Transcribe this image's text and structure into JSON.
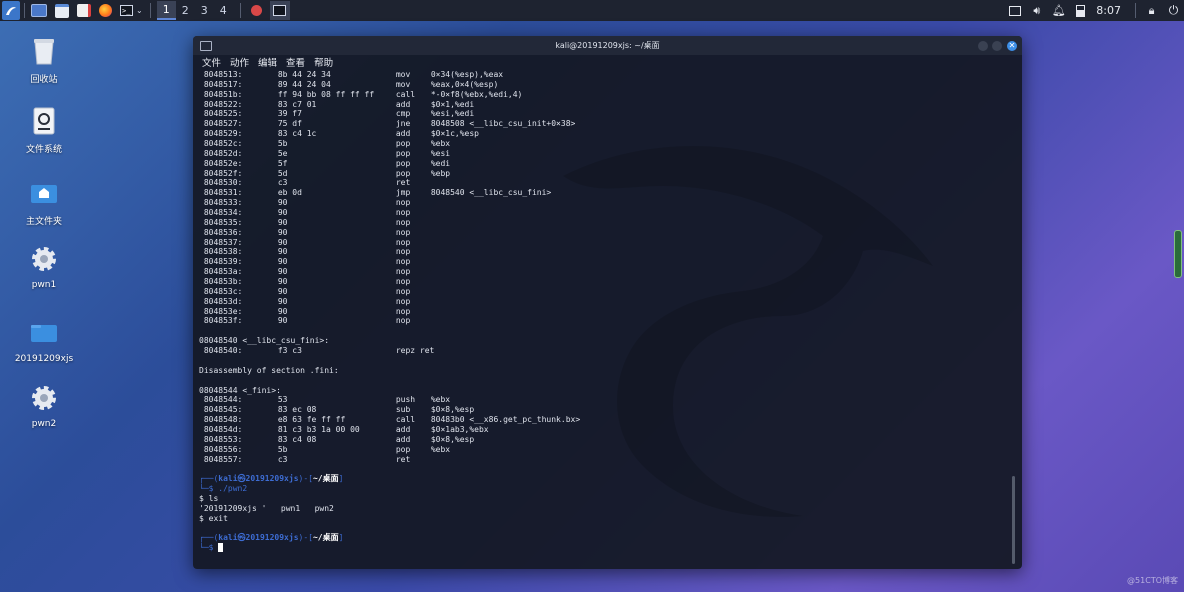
{
  "taskbar": {
    "workspaces": [
      "1",
      "2",
      "3",
      "4"
    ],
    "clock": "8:07"
  },
  "desktop": {
    "icons": [
      {
        "label": "回收站"
      },
      {
        "label": "文件系统"
      },
      {
        "label": "主文件夹"
      },
      {
        "label": "pwn1"
      },
      {
        "label": "20191209xjs"
      },
      {
        "label": "pwn2"
      }
    ]
  },
  "window": {
    "title": "kali@20191209xjs: ~/桌面",
    "menu": [
      "文件",
      "动作",
      "编辑",
      "查看",
      "帮助"
    ]
  },
  "terminal": {
    "disasm1": [
      [
        "8048513:",
        "8b 44 24 34",
        "mov",
        "0×34(%esp),%eax"
      ],
      [
        "8048517:",
        "89 44 24 04",
        "mov",
        "%eax,0×4(%esp)"
      ],
      [
        "804851b:",
        "ff 94 bb 08 ff ff ff",
        "call",
        "*-0×f8(%ebx,%edi,4)"
      ],
      [
        "8048522:",
        "83 c7 01",
        "add",
        "$0×1,%edi"
      ],
      [
        "8048525:",
        "39 f7",
        "cmp",
        "%esi,%edi"
      ],
      [
        "8048527:",
        "75 df",
        "jne",
        "8048508 <__libc_csu_init+0×38>"
      ],
      [
        "8048529:",
        "83 c4 1c",
        "add",
        "$0×1c,%esp"
      ],
      [
        "804852c:",
        "5b",
        "pop",
        "%ebx"
      ],
      [
        "804852d:",
        "5e",
        "pop",
        "%esi"
      ],
      [
        "804852e:",
        "5f",
        "pop",
        "%edi"
      ],
      [
        "804852f:",
        "5d",
        "pop",
        "%ebp"
      ],
      [
        "8048530:",
        "c3",
        "ret",
        ""
      ],
      [
        "8048531:",
        "eb 0d",
        "jmp",
        "8048540 <__libc_csu_fini>"
      ],
      [
        "8048533:",
        "90",
        "nop",
        ""
      ],
      [
        "8048534:",
        "90",
        "nop",
        ""
      ],
      [
        "8048535:",
        "90",
        "nop",
        ""
      ],
      [
        "8048536:",
        "90",
        "nop",
        ""
      ],
      [
        "8048537:",
        "90",
        "nop",
        ""
      ],
      [
        "8048538:",
        "90",
        "nop",
        ""
      ],
      [
        "8048539:",
        "90",
        "nop",
        ""
      ],
      [
        "804853a:",
        "90",
        "nop",
        ""
      ],
      [
        "804853b:",
        "90",
        "nop",
        ""
      ],
      [
        "804853c:",
        "90",
        "nop",
        ""
      ],
      [
        "804853d:",
        "90",
        "nop",
        ""
      ],
      [
        "804853e:",
        "90",
        "nop",
        ""
      ],
      [
        "804853f:",
        "90",
        "nop",
        ""
      ]
    ],
    "label_fini": "08048540 <__libc_csu_fini>:",
    "fini_row": [
      "8048540:",
      "f3 c3",
      "repz ret",
      ""
    ],
    "section_fini": "Disassembly of section .fini:",
    "label_fini2": "08048544 <_fini>:",
    "disasm2": [
      [
        "8048544:",
        "53",
        "push",
        "%ebx"
      ],
      [
        "8048545:",
        "83 ec 08",
        "sub",
        "$0×8,%esp"
      ],
      [
        "8048548:",
        "e8 63 fe ff ff",
        "call",
        "80483b0 <__x86.get_pc_thunk.bx>"
      ],
      [
        "804854d:",
        "81 c3 b3 1a 00 00",
        "add",
        "$0×1ab3,%ebx"
      ],
      [
        "8048553:",
        "83 c4 08",
        "add",
        "$0×8,%esp"
      ],
      [
        "8048556:",
        "5b",
        "pop",
        "%ebx"
      ],
      [
        "8048557:",
        "c3",
        "ret",
        ""
      ]
    ],
    "prompt": {
      "open": "┌──(",
      "user": "kali㉿20191209xjs",
      "sep": ")-[",
      "path": "~/桌面",
      "close": "]",
      "arrow": "└─$ "
    },
    "cmd1": "./pwn2",
    "cmd2": "$ ls",
    "ls_out": "'20191209xjs '   pwn1   pwn2",
    "cmd3": "$ exit"
  },
  "watermark": "@51CTO博客"
}
